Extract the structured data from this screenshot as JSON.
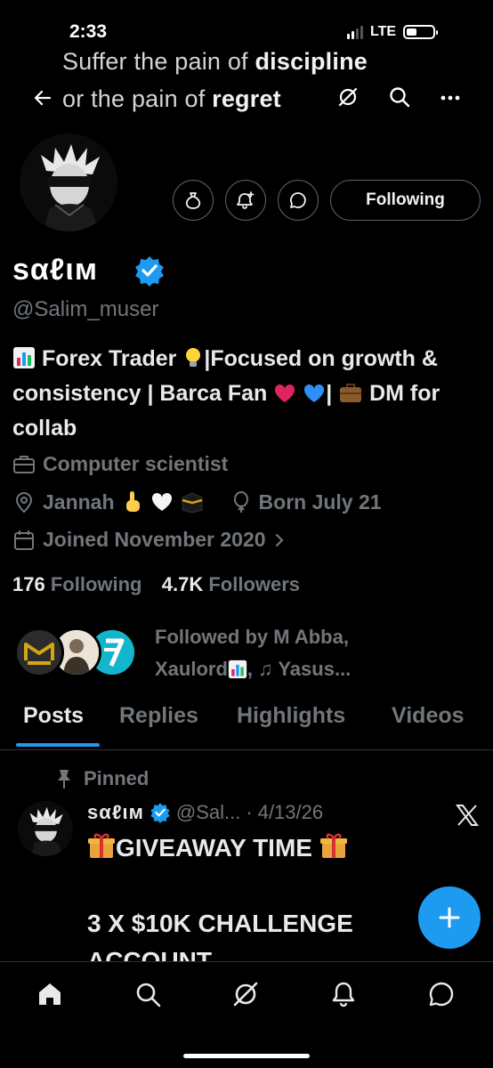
{
  "status": {
    "time": "2:33",
    "network": "LTE"
  },
  "banner": {
    "line1_prefix": "Suffer the pain of ",
    "line1_bold": "discipline",
    "line2_prefix": "or the pain of ",
    "line2_bold": "regret"
  },
  "header": {
    "icons": [
      "back-arrow-icon",
      "grok-icon",
      "search-icon",
      "more-icon"
    ]
  },
  "actions": {
    "following_label": "Following"
  },
  "profile": {
    "display_name": "sαℓιм",
    "handle": "@Salim_muser",
    "bio": {
      "part1": "Forex Trader",
      "part2": "|Focused on growth & consistency | Barca Fan",
      "part3": "|",
      "part4": "DM for collab"
    },
    "profession": "Computer scientist",
    "location": "Jannah",
    "birthday": "Born July 21",
    "joined": "Joined November 2020"
  },
  "stats": {
    "following_count": "176",
    "following_label": "Following",
    "followers_count": "4.7K",
    "followers_label": "Followers"
  },
  "followed_by": {
    "line1": "Followed by M Abba,",
    "line2a": "Xaulord",
    "line2b": ", ♫ Yasus..."
  },
  "tabs": [
    "Posts",
    "Replies",
    "Highlights",
    "Videos"
  ],
  "post": {
    "pinned_label": "Pinned",
    "author_name": "sαℓιм",
    "author_handle": "@Sal...",
    "separator": "·",
    "date": "4/13/26",
    "line1": "GIVEAWAY TIME",
    "line2": "3 X $10K CHALLENGE",
    "line3": "ACCOUNT"
  },
  "colors": {
    "accent": "#1d9bf0",
    "muted": "#71767b",
    "background": "#000000"
  }
}
